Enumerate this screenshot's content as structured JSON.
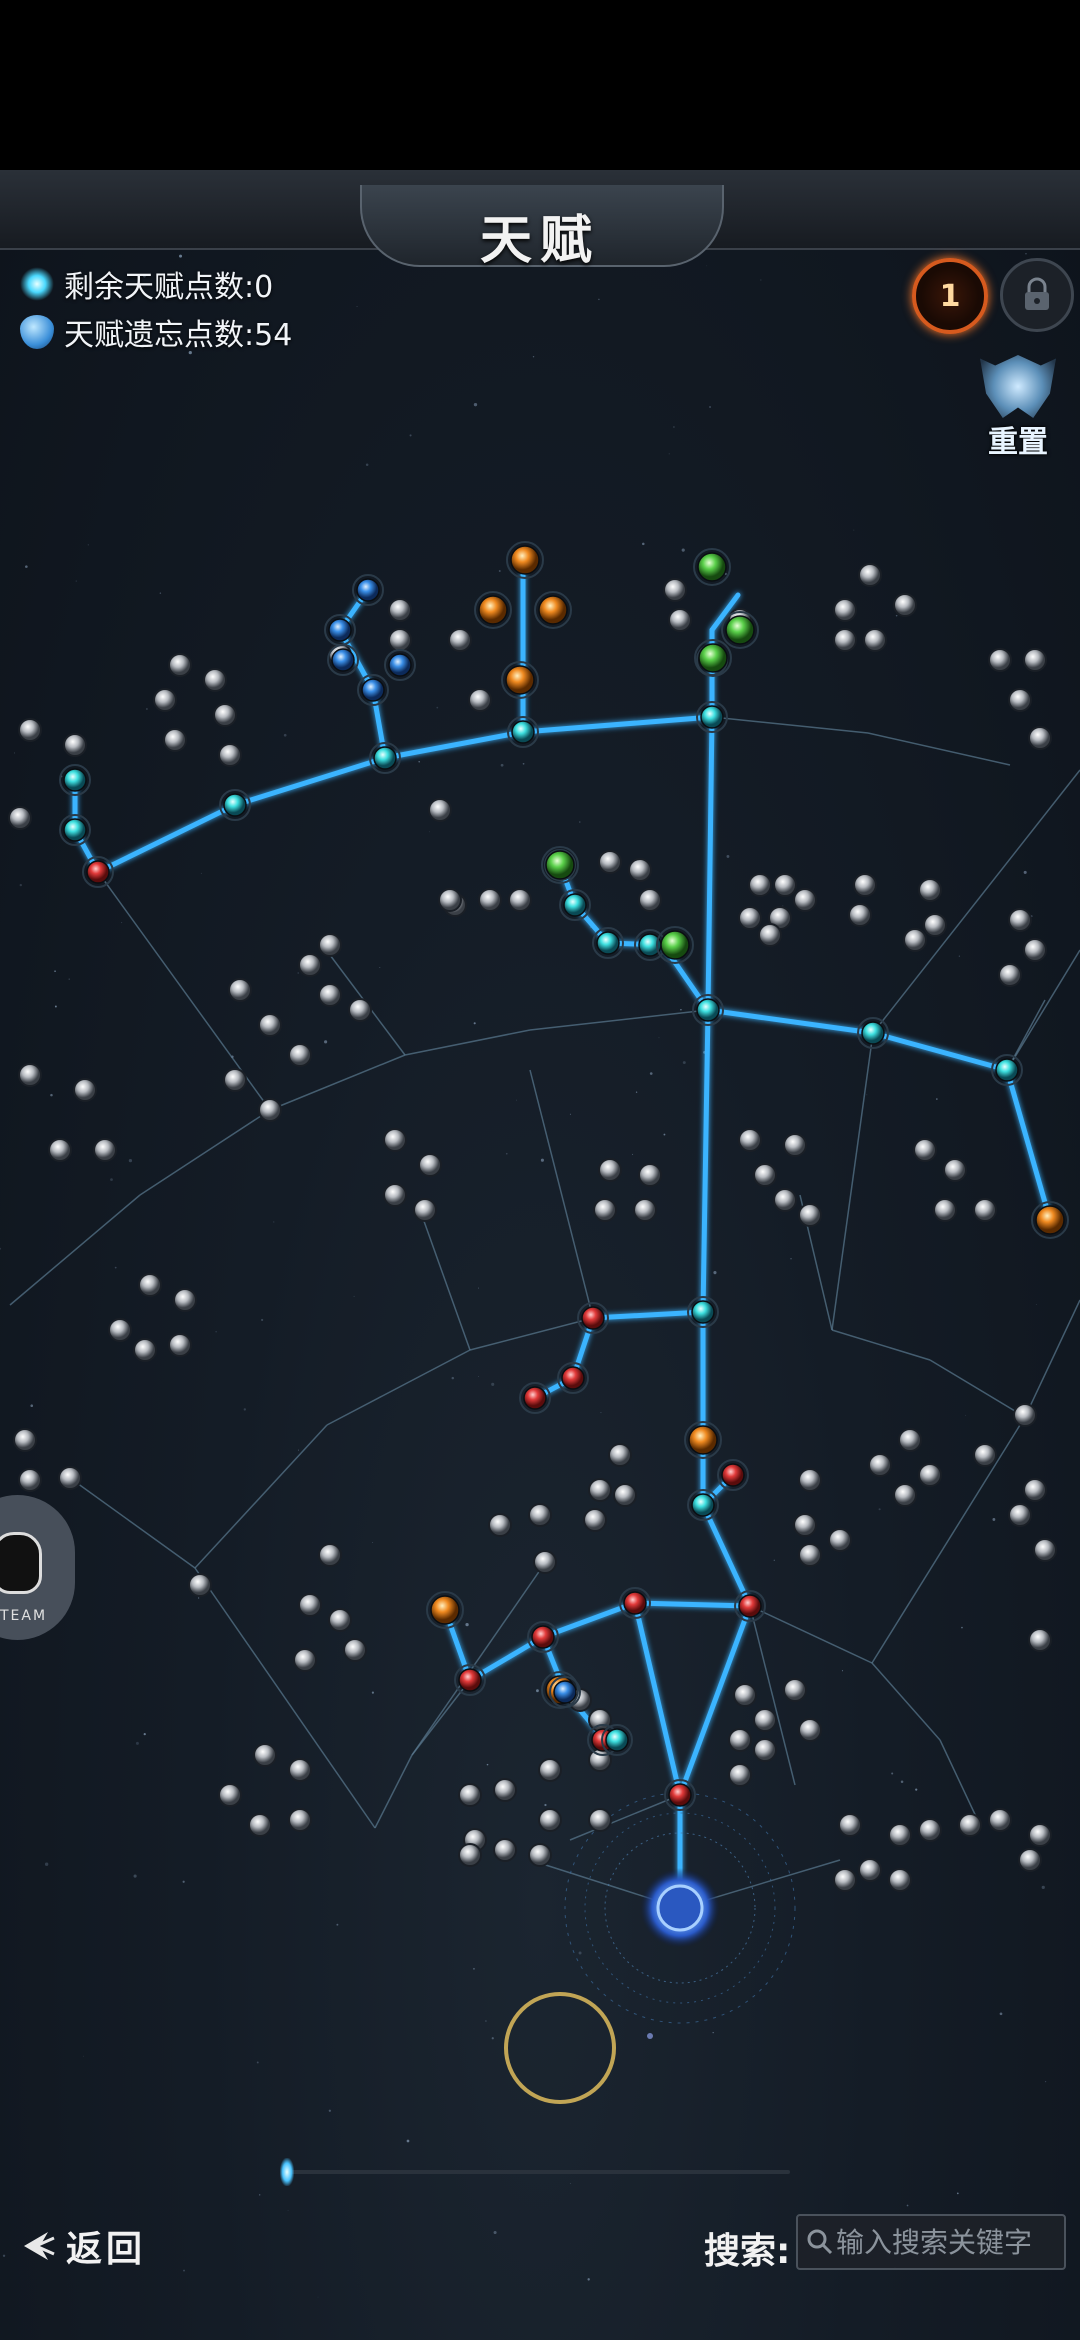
{
  "header": {
    "title": "天赋"
  },
  "stats": {
    "remaining_label": "剩余天赋点数:0",
    "forget_label": "天赋遗忘点数:54"
  },
  "buttons": {
    "level_badge": "1",
    "reset_label": "重置",
    "back_label": "返回",
    "qq_team_label": "TEAM"
  },
  "search": {
    "label": "搜索:",
    "placeholder": "输入搜索关键字"
  },
  "colors": {
    "active_path": "#3ab4ff",
    "inactive_path": "#5a7a90",
    "background": "#141c26",
    "accent_gold": "#d4b45a",
    "node_red": "#e23a3a",
    "node_cyan": "#3ee0e0",
    "node_blue": "#3a8fe8",
    "node_orange": "#f08a20",
    "node_green": "#5ad04a",
    "node_grey": "#b8bcc2"
  },
  "scroll_position": 0.0
}
